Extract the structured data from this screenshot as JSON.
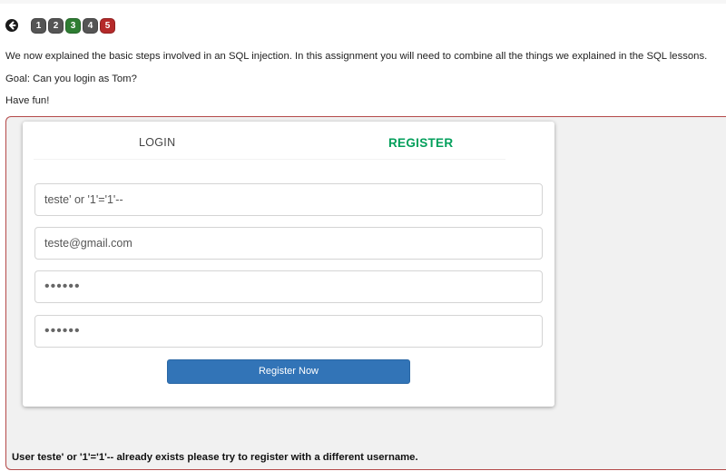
{
  "nav": {
    "pages": [
      {
        "label": "1",
        "color": "#555555"
      },
      {
        "label": "2",
        "color": "#555555"
      },
      {
        "label": "3",
        "color": "#2e7d32"
      },
      {
        "label": "4",
        "color": "#555555"
      },
      {
        "label": "5",
        "color": "#b52a2a"
      }
    ]
  },
  "intro": {
    "line1": "We now explained the basic steps involved in an SQL injection. In this assignment you will need to combine all the things we explained in the SQL lessons.",
    "line2": "Goal: Can you login as Tom?",
    "line3": "Have fun!"
  },
  "tabs": {
    "login": "LOGIN",
    "register": "REGISTER"
  },
  "form": {
    "username_value": "teste' or '1'='1'--",
    "email_value": "teste@gmail.com",
    "password_value": "••••••",
    "confirm_password_value": "••••••",
    "submit_label": "Register Now"
  },
  "feedback": "User teste' or '1'='1'-- already exists please try to register with a different username.",
  "colors": {
    "accent_green": "#029f5b",
    "button_blue": "#3274b7",
    "assignment_border": "#b44a4a"
  }
}
